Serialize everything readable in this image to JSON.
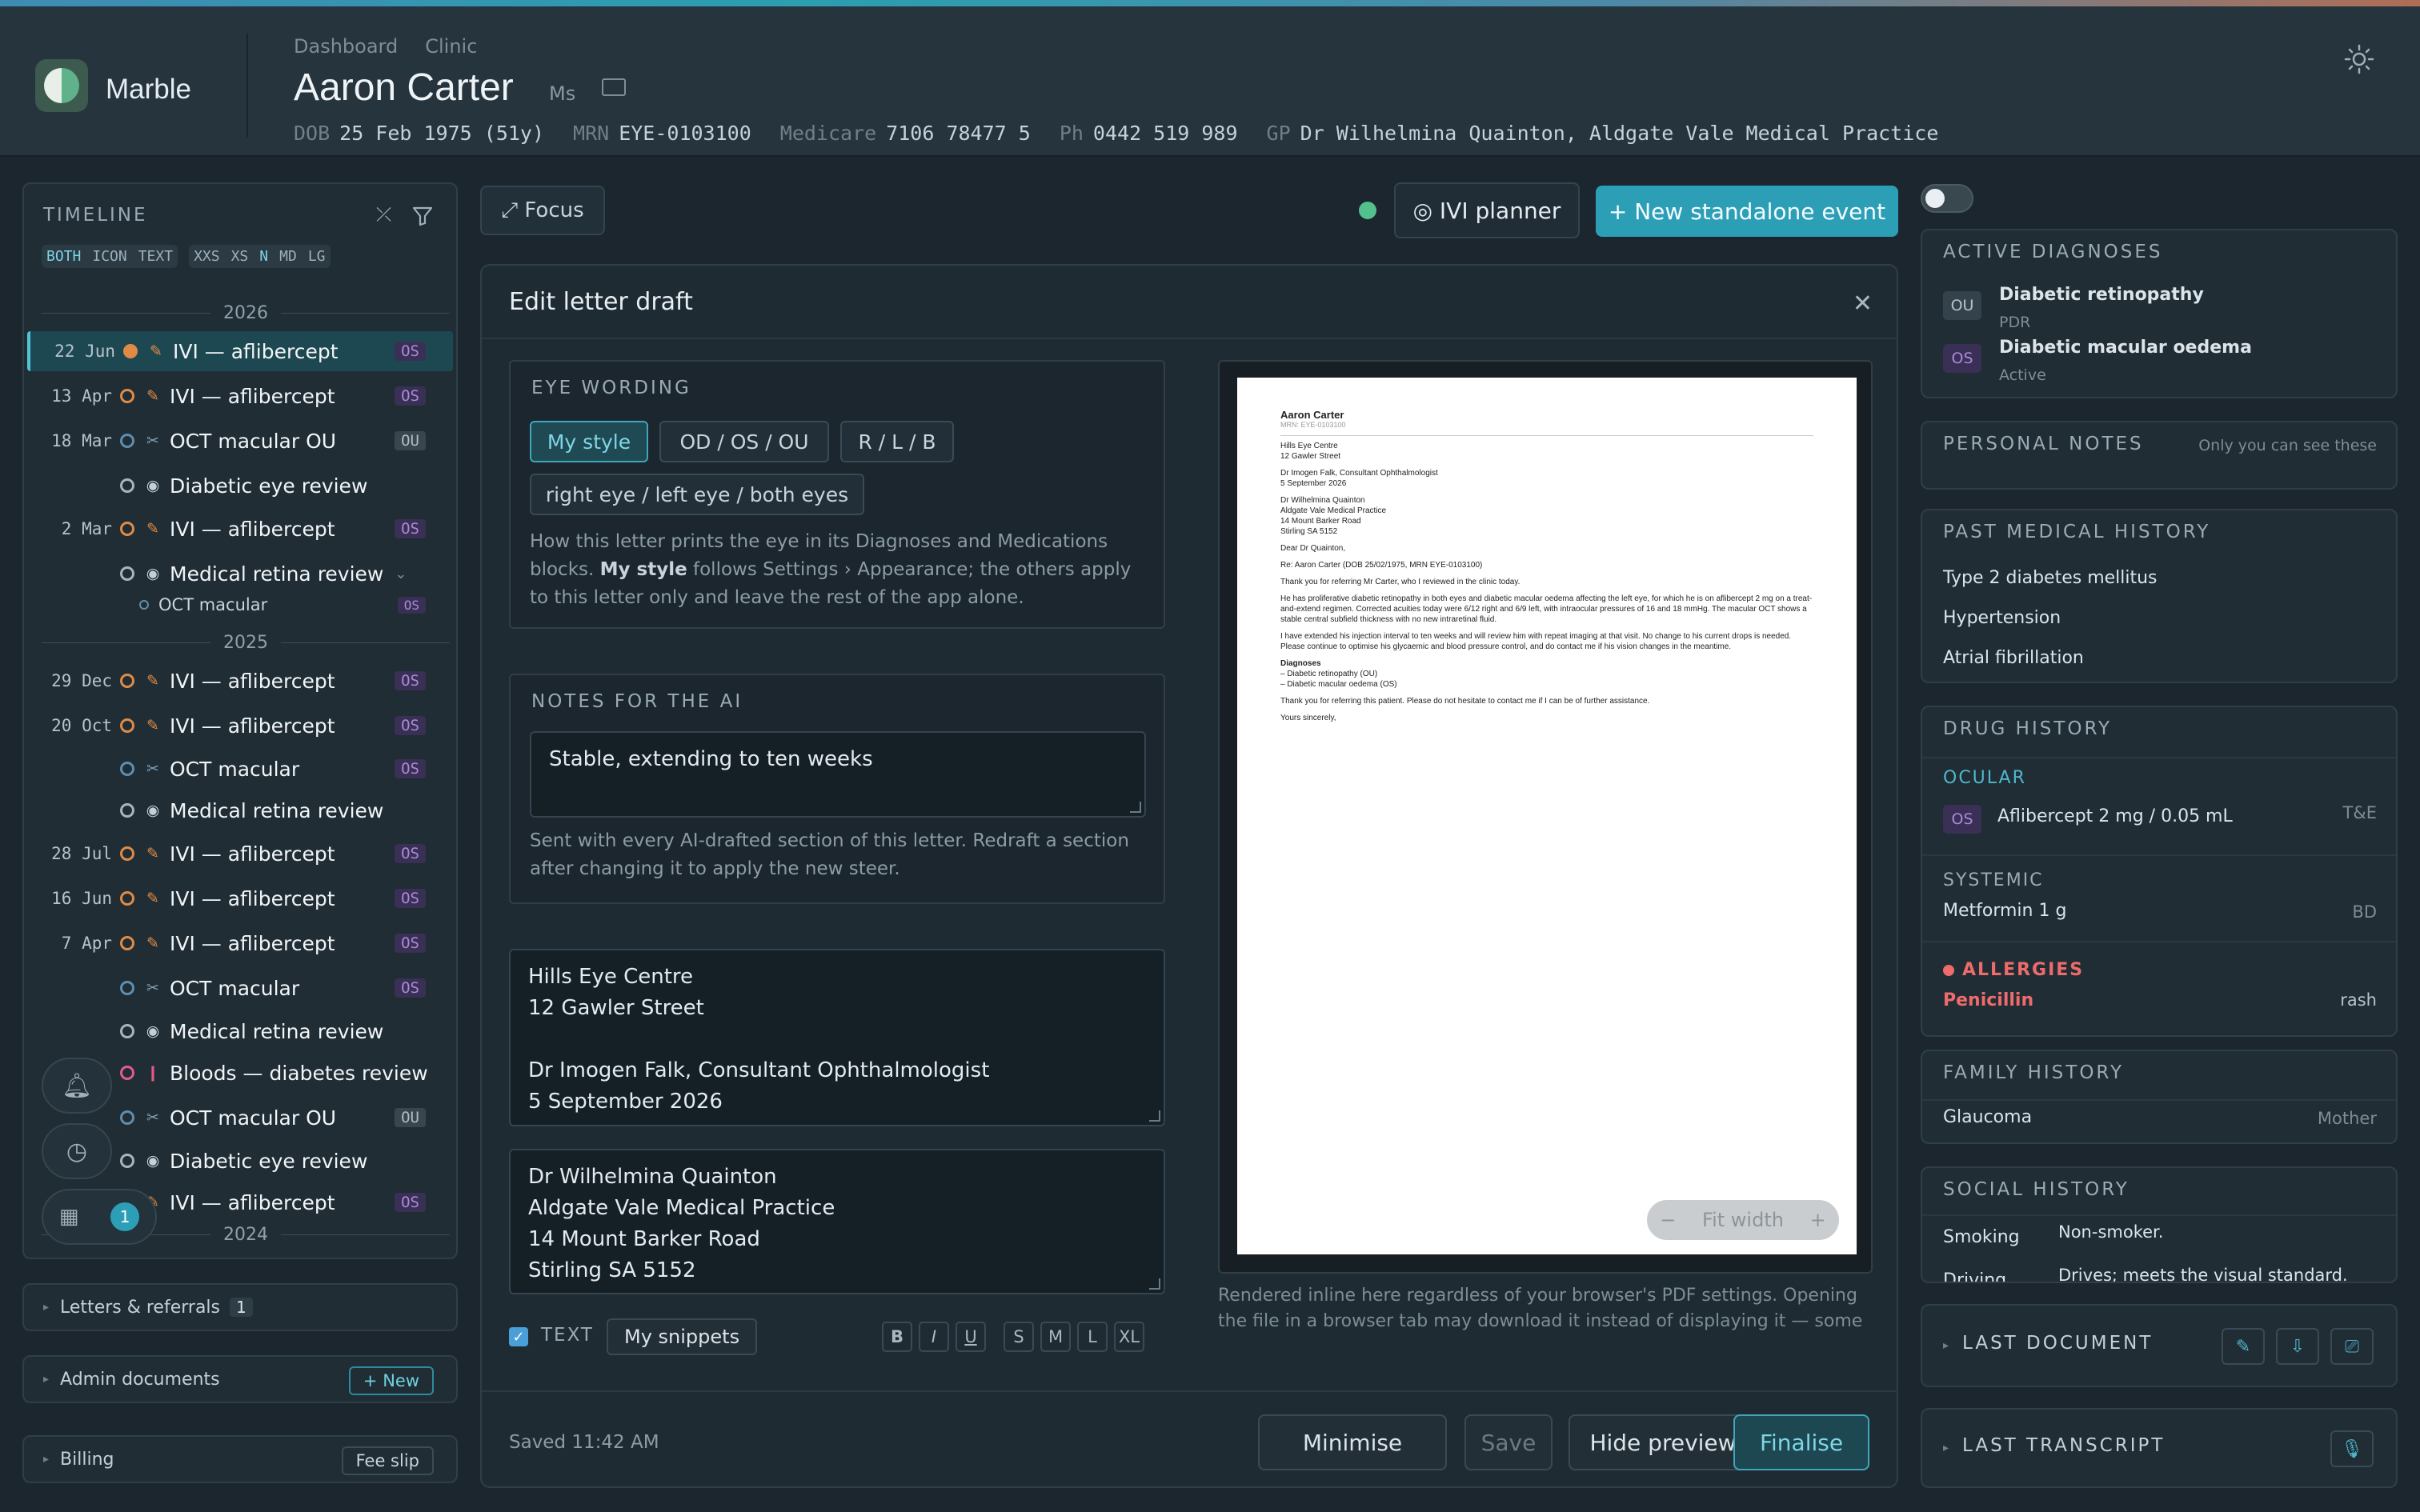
{
  "header": {
    "brand": "Marble",
    "crumbs": [
      "Dashboard",
      "Clinic"
    ],
    "patient_name": "Aaron Carter",
    "patient_title": "Ms",
    "demographics": [
      {
        "label": "DOB",
        "value": "25 Feb 1975 (51y)"
      },
      {
        "label": "MRN",
        "value": "EYE-0103100"
      },
      {
        "label": "Medicare",
        "value": "7106 78477 5"
      },
      {
        "label": "Ph",
        "value": "0442 519 989"
      },
      {
        "label": "GP",
        "value": "Dr Wilhelmina Quainton, Aldgate Vale Medical Practice"
      }
    ]
  },
  "timeline": {
    "title": "TIMELINE",
    "mode_chips": [
      "BOTH",
      "ICON",
      "TEXT"
    ],
    "size_chips": [
      "XXS",
      "XS",
      "N",
      "MD",
      "LG"
    ],
    "years": [
      "2026",
      "2025",
      "2024"
    ],
    "rows": [
      {
        "date": "22 Jun",
        "label": "IVI — aflibercept",
        "eye": "OS",
        "kind": "ivi",
        "selected": true
      },
      {
        "date": "13 Apr",
        "label": "IVI — aflibercept",
        "eye": "OS",
        "kind": "ivi"
      },
      {
        "date": "18 Mar",
        "label": "OCT macular OU",
        "eye": "OU",
        "kind": "oct"
      },
      {
        "date": "",
        "label": "Diabetic eye review",
        "eye": "",
        "kind": "review"
      },
      {
        "date": "2 Mar",
        "label": "IVI — aflibercept",
        "eye": "OS",
        "kind": "ivi"
      },
      {
        "date": "",
        "label": "Medical retina review",
        "eye": "",
        "kind": "review"
      },
      {
        "date": "",
        "label": "OCT macular",
        "eye": "OS",
        "kind": "sub"
      },
      {
        "date": "29 Dec",
        "label": "IVI — aflibercept",
        "eye": "OS",
        "kind": "ivi"
      },
      {
        "date": "20 Oct",
        "label": "IVI — aflibercept",
        "eye": "OS",
        "kind": "ivi"
      },
      {
        "date": "",
        "label": "OCT macular",
        "eye": "OS",
        "kind": "oct"
      },
      {
        "date": "",
        "label": "Medical retina review",
        "eye": "",
        "kind": "review"
      },
      {
        "date": "28 Jul",
        "label": "IVI — aflibercept",
        "eye": "OS",
        "kind": "ivi"
      },
      {
        "date": "16 Jun",
        "label": "IVI — aflibercept",
        "eye": "OS",
        "kind": "ivi"
      },
      {
        "date": "7 Apr",
        "label": "IVI — aflibercept",
        "eye": "OS",
        "kind": "ivi"
      },
      {
        "date": "",
        "label": "OCT macular",
        "eye": "OS",
        "kind": "oct"
      },
      {
        "date": "",
        "label": "Medical retina review",
        "eye": "",
        "kind": "review"
      },
      {
        "date": "",
        "label": "Bloods — diabetes review",
        "eye": "",
        "kind": "bloods"
      },
      {
        "date": "",
        "label": "OCT macular OU",
        "eye": "OU",
        "kind": "oct"
      },
      {
        "date": "",
        "label": "Diabetic eye review",
        "eye": "",
        "kind": "review"
      },
      {
        "date": "",
        "label": "IVI — aflibercept",
        "eye": "OS",
        "kind": "ivi"
      }
    ],
    "notification_count": "1"
  },
  "left_sections": {
    "letters": {
      "label": "Letters & referrals",
      "count": "1"
    },
    "admin": {
      "label": "Admin documents",
      "action": "+ New"
    },
    "billing": {
      "label": "Billing",
      "action": "Fee slip"
    }
  },
  "center_toolbar": {
    "focus": "⤢ Focus",
    "ivi_planner": "◎ IVI planner",
    "new_event": "+ New standalone event"
  },
  "modal": {
    "title": "Edit letter draft",
    "eye_wording": {
      "heading": "EYE WORDING",
      "options": [
        "My style",
        "OD / OS / OU",
        "R / L / B",
        "right eye / left eye / both eyes"
      ],
      "help_pre": "How this letter prints the eye in its Diagnoses and Medications blocks. ",
      "help_bold": "My style",
      "help_post": " follows Settings › Appearance; the others apply to this letter only and leave the rest of the app alone."
    },
    "notes_ai": {
      "heading": "NOTES FOR THE AI",
      "value": "Stable, extending to ten weeks",
      "help": "Sent with every AI-drafted section of this letter. Redraft a section after changing it to apply the new steer."
    },
    "sender_block": "Hills Eye Centre\n12 Gawler Street\n\nDr Imogen Falk, Consultant Ophthalmologist\n5 September 2026",
    "recipient_block": "Dr Wilhelmina Quainton\nAldgate Vale Medical Practice\n14 Mount Barker Road\nStirling SA 5152",
    "text_toggle": "TEXT",
    "snippets": "My snippets",
    "format_buttons": [
      "B",
      "I",
      "U",
      "S",
      "M",
      "L",
      "XL"
    ],
    "preview_note": "Rendered inline here regardless of your browser's PDF settings. Opening the file in a browser tab may download it instead of displaying it — some browsers (e.g. Chrome set to “Download PDFs”) do this; switch your browser to open PDFs in a tab to view it there.",
    "zoom_label": "Fit width",
    "saved": "Saved 11:42 AM",
    "footer_buttons": {
      "minimise": "Minimise",
      "save": "Save",
      "hide_preview": "Hide preview",
      "finalise": "Finalise"
    },
    "letter": {
      "name": "Aaron Carter",
      "mrn": "MRN: EYE-0103100",
      "from": [
        "Hills Eye Centre",
        "12 Gawler Street"
      ],
      "author": [
        "Dr Imogen Falk, Consultant Ophthalmologist",
        "5 September 2026"
      ],
      "to": [
        "Dr Wilhelmina Quainton",
        "Aldgate Vale Medical Practice",
        "14 Mount Barker Road",
        "Stirling SA 5152"
      ],
      "salutation": "Dear Dr Quainton,",
      "re": "Re: Aaron Carter (DOB 25/02/1975, MRN EYE-0103100)",
      "p1": "Thank you for referring Mr Carter, who I reviewed in the clinic today.",
      "p2": "He has proliferative diabetic retinopathy in both eyes and diabetic macular oedema affecting the left eye, for which he is on aflibercept 2 mg on a treat-and-extend regimen. Corrected acuities today were 6/12 right and 6/9 left, with intraocular pressures of 16 and 18 mmHg. The macular OCT shows a stable central subfield thickness with no new intraretinal fluid.",
      "p3": "I have extended his injection interval to ten weeks and will review him with repeat imaging at that visit. No change to his current drops is needed. Please continue to optimise his glycaemic and blood pressure control, and do contact me if his vision changes in the meantime.",
      "dx_head": "Diagnoses",
      "dx": [
        "– Diabetic retinopathy (OU)",
        "– Diabetic macular oedema (OS)"
      ],
      "p4": "Thank you for referring this patient. Please do not hesitate to contact me if I can be of further assistance.",
      "closing": "Yours sincerely,"
    }
  },
  "right": {
    "active_dx": {
      "heading": "ACTIVE DIAGNOSES",
      "items": [
        {
          "eye": "OU",
          "name": "Diabetic retinopathy",
          "sub": "PDR"
        },
        {
          "eye": "OS",
          "name": "Diabetic macular oedema",
          "sub": "Active"
        }
      ]
    },
    "personal_notes": {
      "heading": "PERSONAL NOTES",
      "hint": "Only you can see these"
    },
    "pmh": {
      "heading": "PAST MEDICAL HISTORY",
      "items": [
        "Type 2 diabetes mellitus",
        "Hypertension",
        "Atrial fibrillation"
      ]
    },
    "drug": {
      "heading": "DRUG HISTORY",
      "ocular_label": "OCULAR",
      "ocular": {
        "eye": "OS",
        "name": "Aflibercept 2 mg / 0.05 mL",
        "note": "T&E"
      },
      "systemic_label": "SYSTEMIC",
      "systemic": {
        "name": "Metformin 1 g",
        "note": "BD"
      },
      "allergies_label": "ALLERGIES",
      "allergy": {
        "name": "Penicillin",
        "note": "rash"
      }
    },
    "family": {
      "heading": "FAMILY HISTORY",
      "name": "Glaucoma",
      "note": "Mother"
    },
    "social": {
      "heading": "SOCIAL HISTORY",
      "rows": [
        {
          "k": "Smoking",
          "v": "Non-smoker."
        },
        {
          "k": "Driving",
          "v": "Drives; meets the visual standard."
        }
      ]
    },
    "last_document": "LAST DOCUMENT",
    "last_transcript": "LAST TRANSCRIPT"
  }
}
